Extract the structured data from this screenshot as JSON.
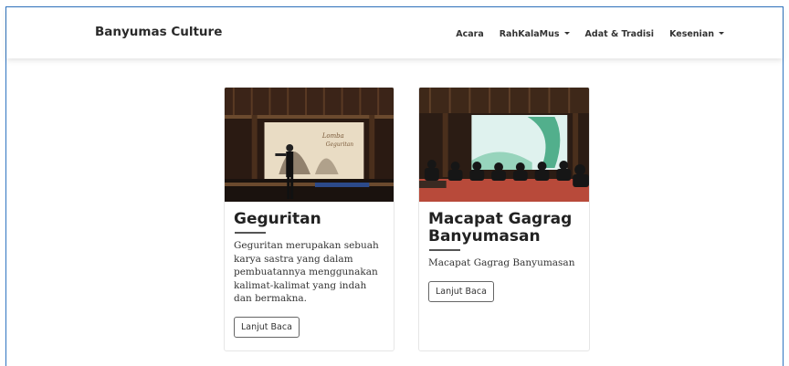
{
  "navbar": {
    "brand": "Banyumas Culture",
    "items": [
      {
        "label": "Acara",
        "dropdown": false
      },
      {
        "label": "RahKalaMus",
        "dropdown": true
      },
      {
        "label": "Adat & Tradisi",
        "dropdown": false
      },
      {
        "label": "Kesenian",
        "dropdown": true
      }
    ]
  },
  "cards": [
    {
      "title": "Geguritan",
      "text": "Geguritan merupakan sebuah karya sastra yang dalam pembuatannya menggunakan kalimat-kalimat yang indah dan bermakna.",
      "button": "Lanjut Baca",
      "image": "geguritan-performance-photo"
    },
    {
      "title": "Macapat Gagrag Banyumasan",
      "text": "Macapat Gagrag Banyumasan",
      "button": "Lanjut Baca",
      "image": "macapat-gathering-photo"
    }
  ],
  "colors": {
    "frame_border": "#2f74c0",
    "text": "#222222"
  }
}
